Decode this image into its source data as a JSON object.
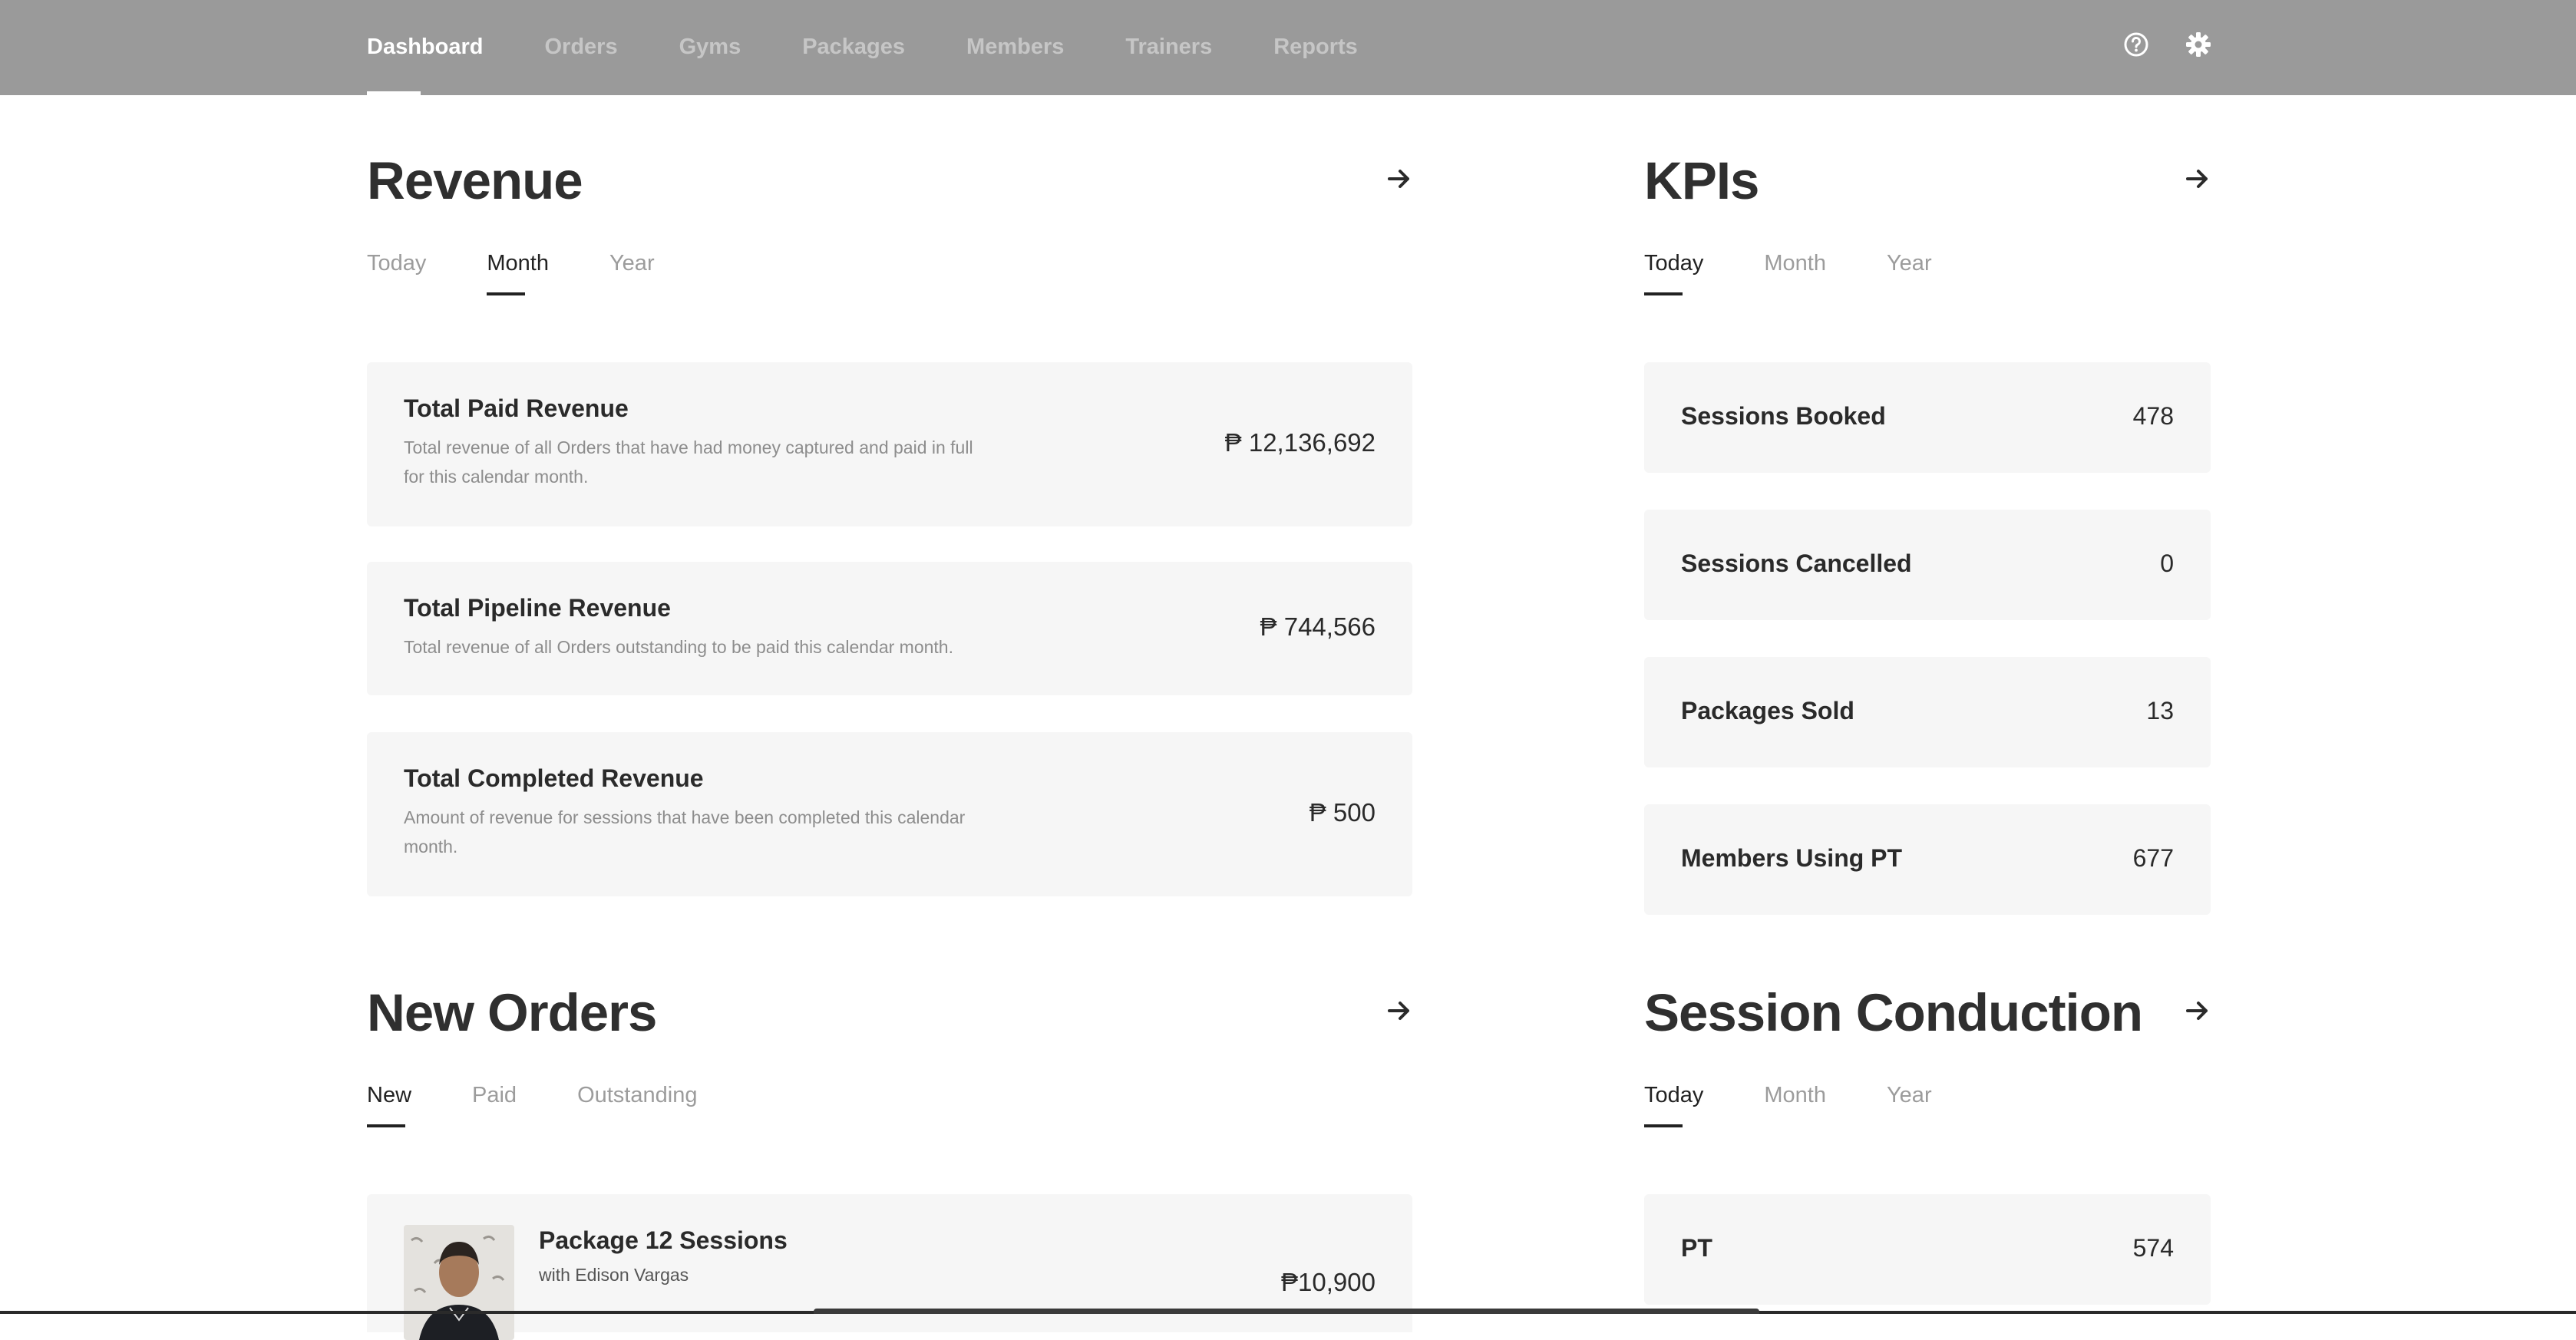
{
  "nav": {
    "items": [
      "Dashboard",
      "Orders",
      "Gyms",
      "Packages",
      "Members",
      "Trainers",
      "Reports"
    ],
    "active": "Dashboard",
    "icons": [
      "help-circle-icon",
      "gear-icon"
    ]
  },
  "revenue": {
    "title": "Revenue",
    "tabs": [
      "Today",
      "Month",
      "Year"
    ],
    "active_tab": "Month",
    "cards": [
      {
        "title": "Total Paid Revenue",
        "desc": "Total revenue of all Orders that have had money captured and paid in full for this calendar month.",
        "value": "₱ 12,136,692"
      },
      {
        "title": "Total Pipeline Revenue",
        "desc": "Total revenue of all Orders outstanding to be paid this calendar month.",
        "value": "₱ 744,566"
      },
      {
        "title": "Total Completed Revenue",
        "desc": "Amount of revenue for sessions that have been completed this calendar month.",
        "value": "₱ 500"
      }
    ]
  },
  "kpis": {
    "title": "KPIs",
    "tabs": [
      "Today",
      "Month",
      "Year"
    ],
    "active_tab": "Today",
    "items": [
      {
        "label": "Sessions Booked",
        "value": "478"
      },
      {
        "label": "Sessions Cancelled",
        "value": "0"
      },
      {
        "label": "Packages Sold",
        "value": "13"
      },
      {
        "label": "Members Using PT",
        "value": "677"
      }
    ]
  },
  "new_orders": {
    "title": "New Orders",
    "tabs": [
      "New",
      "Paid",
      "Outstanding"
    ],
    "active_tab": "New",
    "orders": [
      {
        "title": "Package 12 Sessions",
        "subtitle": "with Edison Vargas",
        "price": "₱10,900"
      }
    ]
  },
  "session_conduction": {
    "title": "Session Conduction",
    "tabs": [
      "Today",
      "Month",
      "Year"
    ],
    "active_tab": "Today",
    "items": [
      {
        "label": "PT",
        "value": "574"
      }
    ]
  },
  "colors": {
    "topbar": "#9a9a9a",
    "card_bg": "#f6f6f6",
    "text": "#2f2f2f",
    "muted": "#9c9c9c"
  }
}
